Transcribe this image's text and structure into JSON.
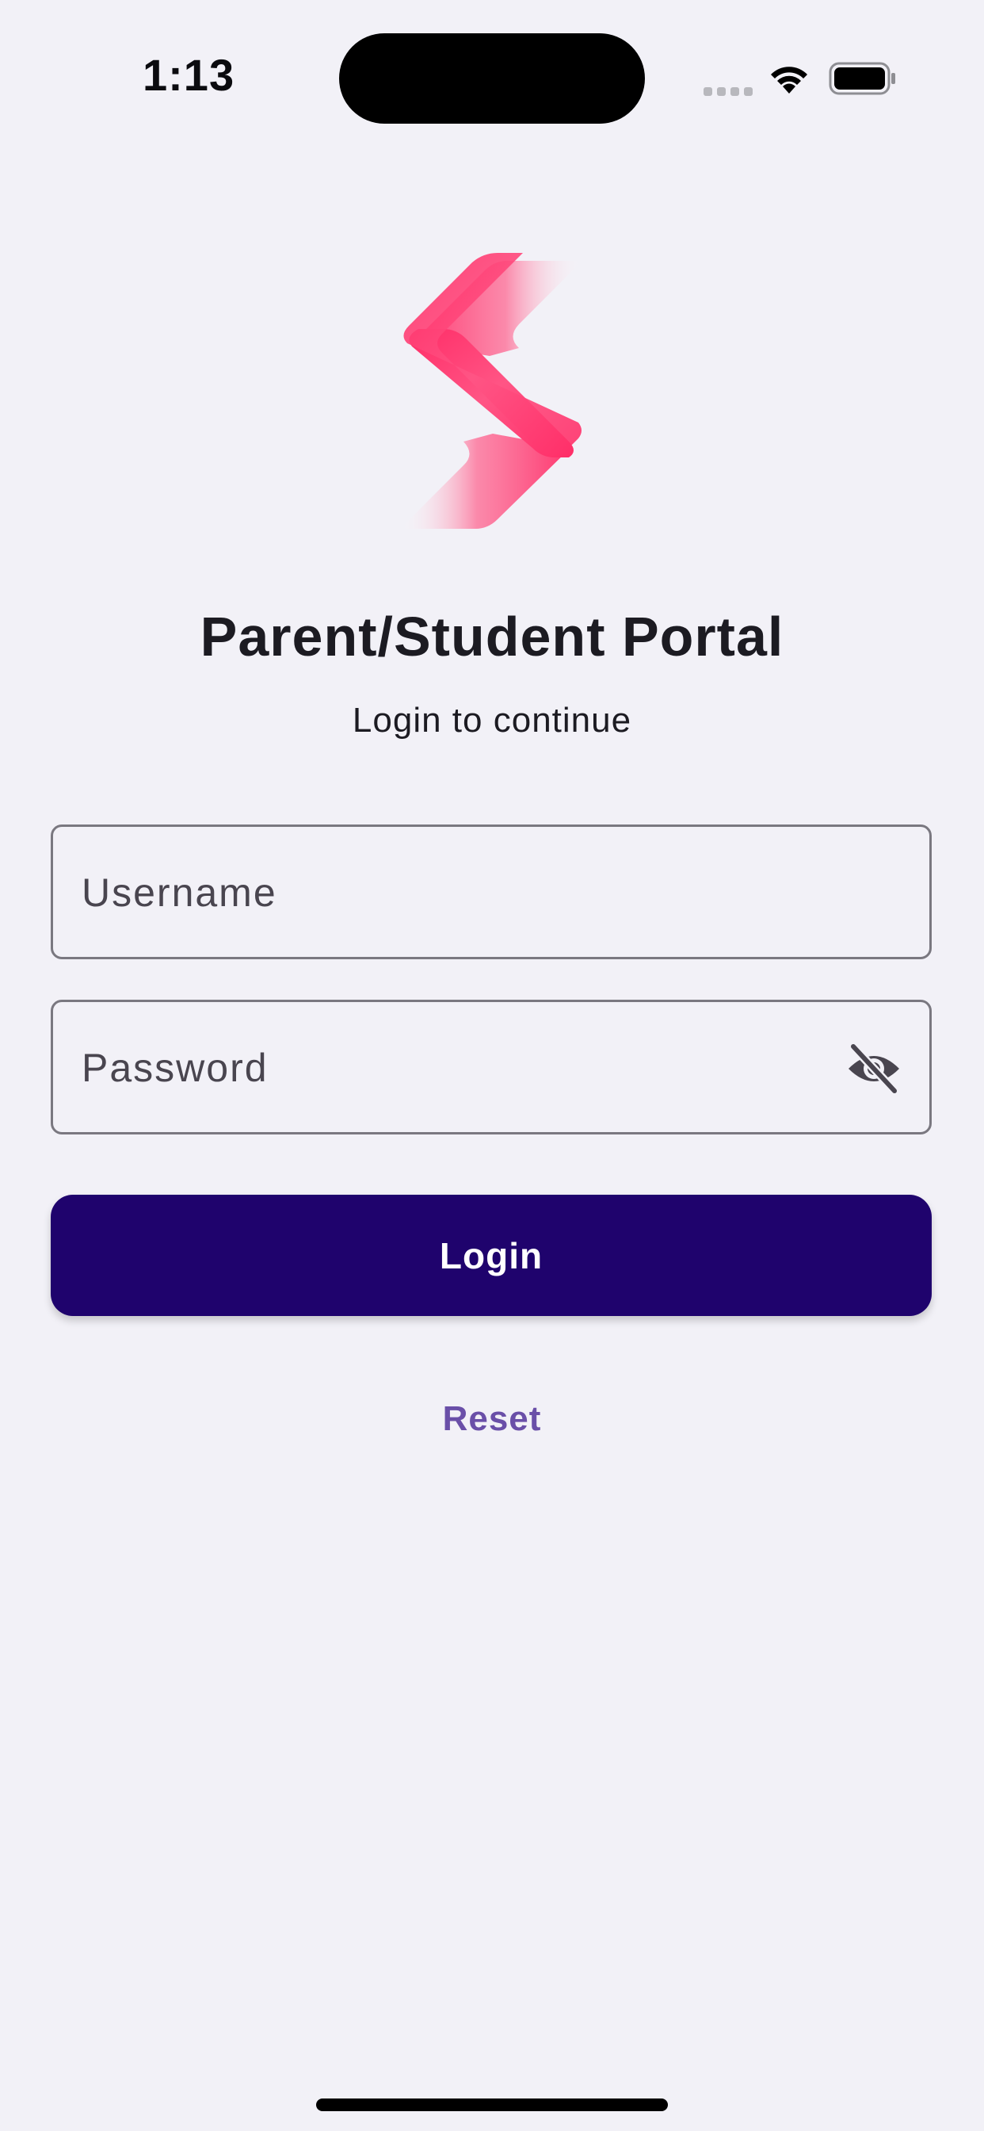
{
  "status_bar": {
    "time": "1:13",
    "wifi_icon": "wifi-icon",
    "battery_icon": "battery-icon"
  },
  "colors": {
    "background": "#f2f1f7",
    "logo_primary": "#ff2d67",
    "button_bg": "#1f036d",
    "link": "#6a4fa8"
  },
  "logo": {
    "icon": "brand-logo-s"
  },
  "header": {
    "title": "Parent/Student Portal",
    "subtitle": "Login to continue"
  },
  "form": {
    "username_placeholder": "Username",
    "username_value": "",
    "password_placeholder": "Password",
    "password_value": "",
    "password_toggle_icon": "eye-off-icon",
    "login_label": "Login",
    "reset_label": "Reset"
  }
}
